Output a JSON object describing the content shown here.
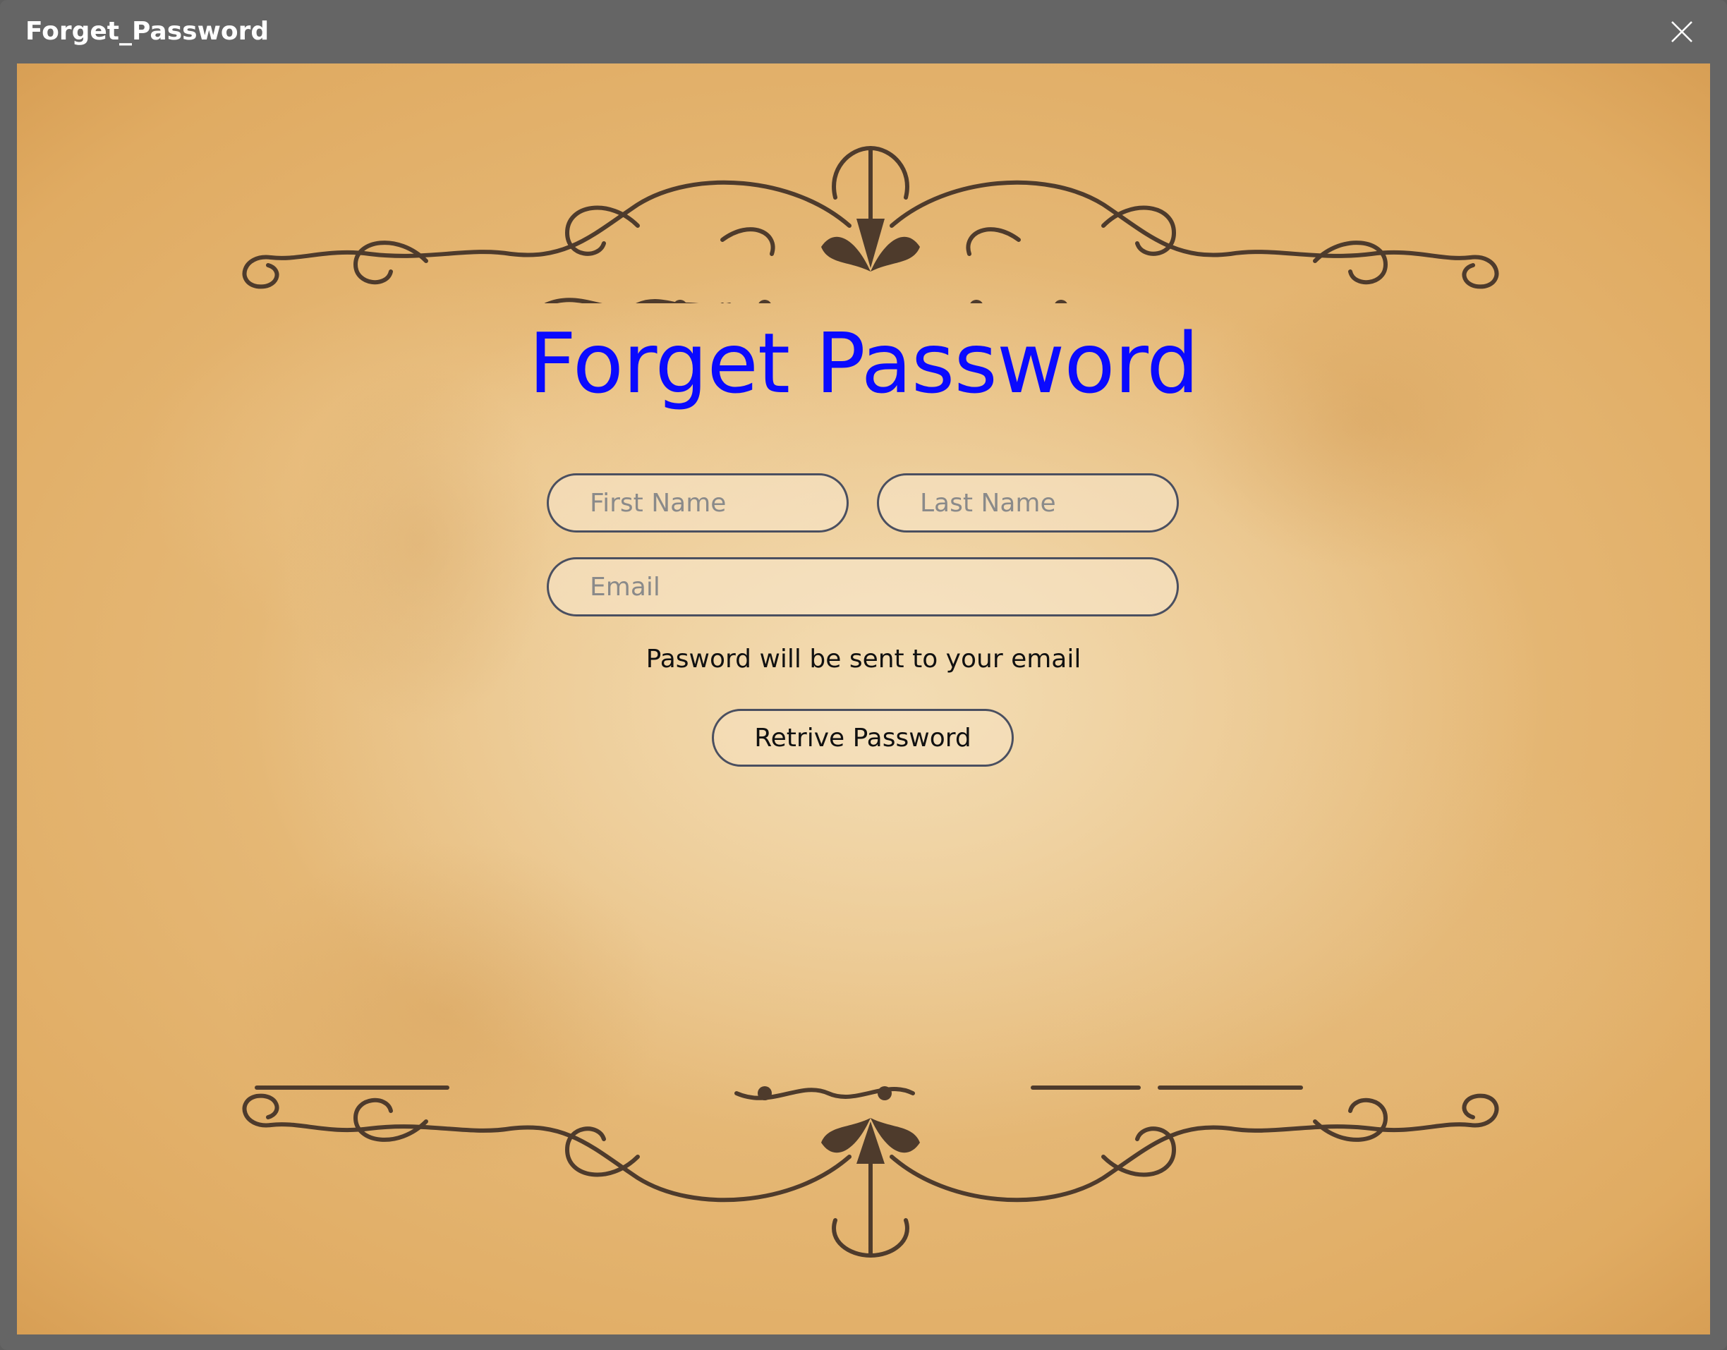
{
  "window": {
    "title": "Forget_Password"
  },
  "form": {
    "heading": "Forget Password",
    "first_name_placeholder": "First Name",
    "last_name_placeholder": "Last Name",
    "email_placeholder": "Email",
    "hint": "Pasword will be sent to your email",
    "submit_label": "Retrive Password"
  },
  "colors": {
    "heading": "#0a0aff",
    "titlebar": "#656565",
    "parchment": "#ecc990",
    "ornament": "#4e3b2c"
  }
}
